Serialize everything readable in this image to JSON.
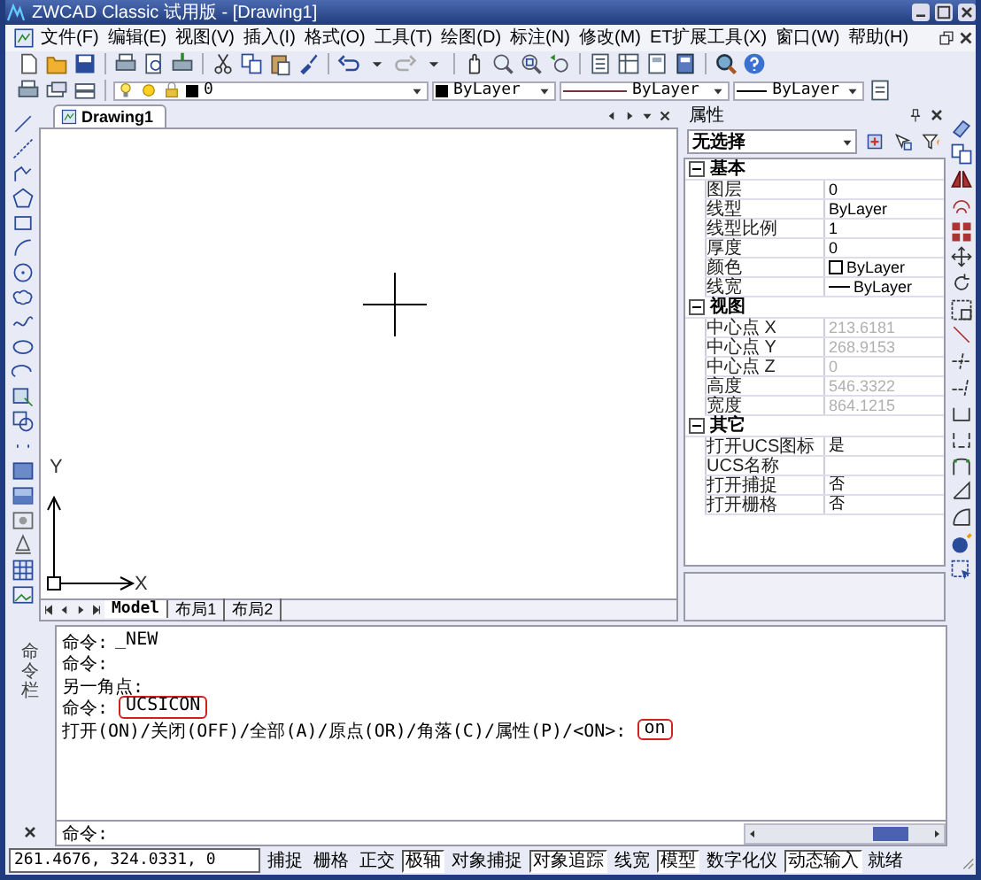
{
  "window": {
    "title": "ZWCAD Classic 试用版 - [Drawing1]"
  },
  "menu": [
    "文件(F)",
    "编辑(E)",
    "视图(V)",
    "插入(I)",
    "格式(O)",
    "工具(T)",
    "绘图(D)",
    "标注(N)",
    "修改(M)",
    "ET扩展工具(X)",
    "窗口(W)",
    "帮助(H)"
  ],
  "layer_bar": {
    "layer": "0",
    "color_setting": "ByLayer",
    "linetype": "ByLayer",
    "lineweight": "ByLayer"
  },
  "document_tab": {
    "title": "Drawing1"
  },
  "canvas": {
    "axis_x": "X",
    "axis_y": "Y"
  },
  "layout_tabs": [
    {
      "label": "Model",
      "selected": true
    },
    {
      "label": "布局1",
      "selected": false
    },
    {
      "label": "布局2",
      "selected": false
    }
  ],
  "properties": {
    "title": "属性",
    "selection": "无选择",
    "groups": [
      {
        "name": "基本",
        "expanded": true,
        "rows": [
          {
            "label": "图层",
            "value": "0",
            "kind": "text",
            "dimmed": false
          },
          {
            "label": "线型",
            "value": "ByLayer",
            "kind": "text",
            "dimmed": false
          },
          {
            "label": "线型比例",
            "value": "1",
            "kind": "text",
            "dimmed": false
          },
          {
            "label": "厚度",
            "value": "0",
            "kind": "text",
            "dimmed": false
          },
          {
            "label": "颜色",
            "value": "ByLayer",
            "kind": "color",
            "dimmed": false
          },
          {
            "label": "线宽",
            "value": "ByLayer",
            "kind": "lineweight",
            "dimmed": false
          }
        ]
      },
      {
        "name": "视图",
        "expanded": true,
        "rows": [
          {
            "label": "中心点 X",
            "value": "213.6181",
            "kind": "text",
            "dimmed": true
          },
          {
            "label": "中心点 Y",
            "value": "268.9153",
            "kind": "text",
            "dimmed": true
          },
          {
            "label": "中心点 Z",
            "value": "0",
            "kind": "text",
            "dimmed": true
          },
          {
            "label": "高度",
            "value": "546.3322",
            "kind": "text",
            "dimmed": true
          },
          {
            "label": "宽度",
            "value": "864.1215",
            "kind": "text",
            "dimmed": true
          }
        ]
      },
      {
        "name": "其它",
        "expanded": true,
        "rows": [
          {
            "label": "打开UCS图标",
            "value": "是",
            "kind": "text",
            "dimmed": false
          },
          {
            "label": "UCS名称"
          },
          {
            "label": "打开捕捉",
            "value": "否",
            "kind": "text",
            "dimmed": false
          },
          {
            "label": "打开栅格",
            "value": "否",
            "kind": "text",
            "dimmed": false
          }
        ]
      }
    ]
  },
  "command_panel": {
    "label": "命令栏",
    "history": [
      {
        "prompt": "命令:",
        "input": "_NEW",
        "highlighted": false
      },
      {
        "prompt": "命令:"
      },
      {
        "prompt": "另一角点:"
      },
      {
        "prompt": "命令:",
        "input": "UCSICON",
        "highlighted": true
      },
      {
        "prompt": "打开(ON)/关闭(OFF)/全部(A)/原点(OR)/角落(C)/属性(P)/<ON>:",
        "input": "on",
        "highlighted": true
      }
    ],
    "prompt": "命令:"
  },
  "status_bar": {
    "coordinates": "261.4676, 324.0331, 0",
    "toggles": [
      {
        "label": "捕捉",
        "on": false
      },
      {
        "label": "栅格",
        "on": false
      },
      {
        "label": "正交",
        "on": false
      },
      {
        "label": "极轴",
        "on": true
      },
      {
        "label": "对象捕捉",
        "on": false
      },
      {
        "label": "对象追踪",
        "on": true
      },
      {
        "label": "线宽",
        "on": false
      },
      {
        "label": "模型",
        "on": true
      },
      {
        "label": "数字化仪",
        "on": false
      },
      {
        "label": "动态输入",
        "on": true
      }
    ],
    "state": "就绪"
  }
}
